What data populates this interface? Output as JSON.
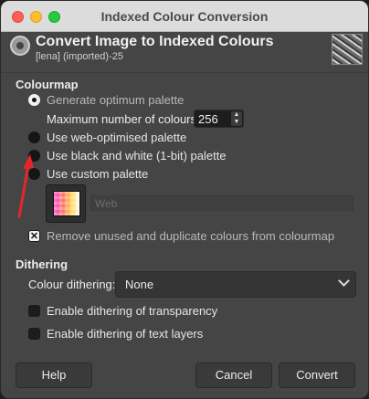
{
  "window": {
    "title": "Indexed Colour Conversion"
  },
  "header": {
    "title": "Convert Image to Indexed Colours",
    "subtitle": "[lena] (imported)-25"
  },
  "colourmap": {
    "section_title": "Colourmap",
    "options": [
      {
        "label": "Generate optimum palette",
        "selected": true
      },
      {
        "label": "Use web-optimised palette",
        "selected": false
      },
      {
        "label": "Use black and white (1-bit) palette",
        "selected": false
      },
      {
        "label": "Use custom palette",
        "selected": false
      }
    ],
    "max_colours_label": "Maximum number of colours:",
    "max_colours_value": "256",
    "custom_palette_name": "Web",
    "remove_unused_label": "Remove unused and duplicate colours from colourmap",
    "remove_unused_checked": true
  },
  "dithering": {
    "section_title": "Dithering",
    "colour_dithering_label": "Colour dithering:",
    "colour_dithering_value": "None",
    "transparency_label": "Enable dithering of transparency",
    "text_layers_label": "Enable dithering of text layers"
  },
  "buttons": {
    "help": "Help",
    "cancel": "Cancel",
    "convert": "Convert"
  },
  "annotation": {
    "arrow_color": "#e8262a"
  }
}
